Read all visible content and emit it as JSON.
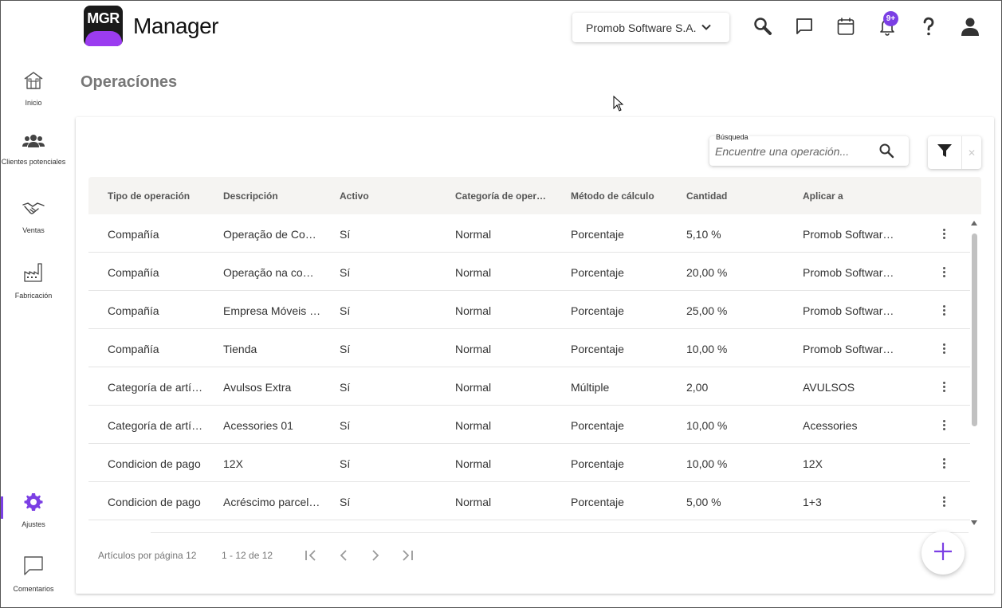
{
  "header": {
    "logo_text": "MGR",
    "app_title": "Manager",
    "company": "Promob Software S.A.",
    "notification_badge": "9+"
  },
  "sidebar": {
    "items": [
      {
        "label": "Inicio",
        "icon": "home-icon"
      },
      {
        "label": "Clientes potenciales",
        "icon": "users-icon"
      },
      {
        "label": "Ventas",
        "icon": "handshake-icon"
      },
      {
        "label": "Fabricación",
        "icon": "factory-icon"
      },
      {
        "label": "Ajustes",
        "icon": "gear-icon",
        "active": true
      },
      {
        "label": "Comentarios",
        "icon": "comment-icon"
      }
    ]
  },
  "page": {
    "title": "Operacíones"
  },
  "search": {
    "label": "Búsqueda",
    "placeholder": "Encuentre una operación..."
  },
  "table": {
    "columns": [
      "Tipo de operación",
      "Descripción",
      "Activo",
      "Categoría de operación",
      "Método de cálculo",
      "Cantidad",
      "Aplicar a"
    ],
    "rows": [
      [
        "Compañía",
        "Operação de Compañía",
        "Sí",
        "Normal",
        "Porcentaje",
        "5,10 %",
        "Promob Software S.A."
      ],
      [
        "Compañía",
        "Operação na compañía",
        "Sí",
        "Normal",
        "Porcentaje",
        "20,00 %",
        "Promob Software S.A."
      ],
      [
        "Compañía",
        "Empresa Móveis Ltda",
        "Sí",
        "Normal",
        "Porcentaje",
        "25,00 %",
        "Promob Software S.A."
      ],
      [
        "Compañía",
        "Tienda",
        "Sí",
        "Normal",
        "Porcentaje",
        "10,00 %",
        "Promob Software S.A."
      ],
      [
        "Categoría de artículo",
        "Avulsos Extra",
        "Sí",
        "Normal",
        "Múltiple",
        "2,00",
        "AVULSOS"
      ],
      [
        "Categoría de artículo",
        "Acessories 01",
        "Sí",
        "Normal",
        "Porcentaje",
        "10,00 %",
        "Acessories"
      ],
      [
        "Condicion de pago",
        "12X",
        "Sí",
        "Normal",
        "Porcentaje",
        "10,00 %",
        "12X"
      ],
      [
        "Condicion de pago",
        "Acréscimo parcelado",
        "Sí",
        "Normal",
        "Porcentaje",
        "5,00 %",
        "1+3"
      ]
    ]
  },
  "pagination": {
    "per_page_label": "Artículos por página",
    "per_page": "12",
    "range": "1 - 12 de 12"
  },
  "colors": {
    "accent": "#7b3fe4",
    "logo_purple": "#9b3cf0",
    "header_bg": "#f5f4f2"
  }
}
